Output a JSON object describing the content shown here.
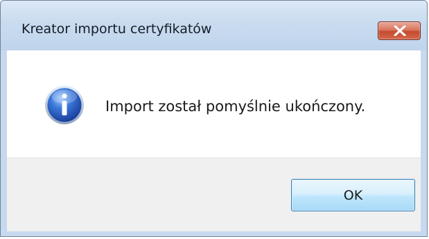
{
  "window": {
    "title": "Kreator importu certyfikatów",
    "close_icon": "close-icon"
  },
  "dialog": {
    "icon": "info-icon",
    "message": "Import został pomyślnie ukończony.",
    "ok_label": "OK"
  },
  "colors": {
    "frame": "#c6d9ee",
    "close_button": "#c54b2f",
    "info_icon": "#2d63c8",
    "ok_button": "#bee6fd"
  }
}
